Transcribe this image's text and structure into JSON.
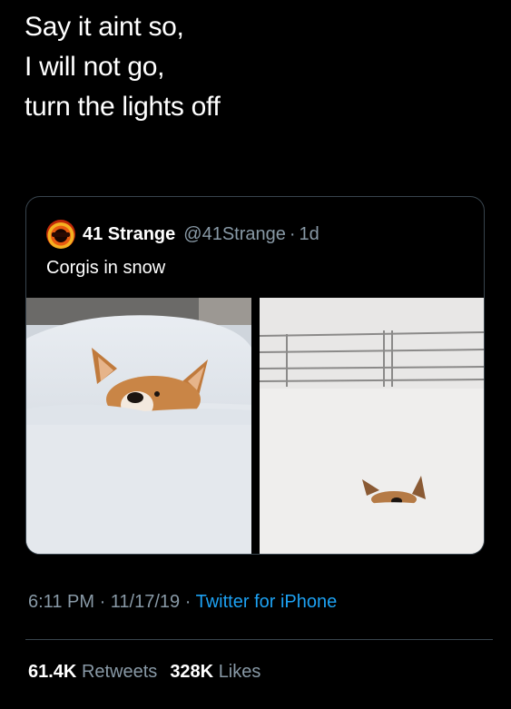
{
  "tweet": {
    "lines": [
      "Say it aint so,",
      "I will not go,",
      "turn the lights off"
    ]
  },
  "quoted_tweet": {
    "display_name": "41 Strange",
    "handle": "@41Strange",
    "separator": "·",
    "age": "1d",
    "text": "Corgis in snow",
    "avatar_icon": "profile-avatar-icon",
    "images": [
      "corgi-in-snow-photo-1",
      "corgi-in-snow-photo-2"
    ]
  },
  "meta": {
    "time": "6:11 PM",
    "sep1": "·",
    "date": "11/17/19",
    "sep2": "·",
    "source": "Twitter for iPhone"
  },
  "stats": {
    "retweets_count": "61.4K",
    "retweets_label": "Retweets",
    "likes_count": "328K",
    "likes_label": "Likes"
  },
  "colors": {
    "background": "#000000",
    "text": "#ffffff",
    "muted": "#8899a6",
    "link": "#1da1f2",
    "border": "#38444d"
  }
}
